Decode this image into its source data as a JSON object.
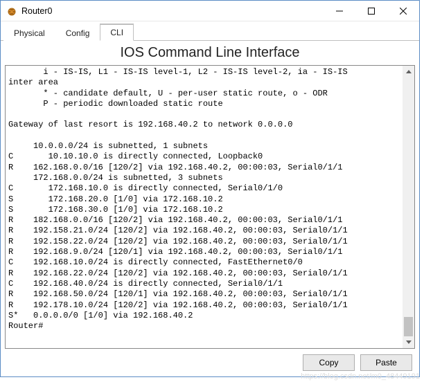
{
  "window": {
    "title": "Router0"
  },
  "tabs": [
    {
      "label": "Physical"
    },
    {
      "label": "Config"
    },
    {
      "label": "CLI"
    }
  ],
  "cli": {
    "heading": "IOS Command Line Interface",
    "lines": [
      "       i - IS-IS, L1 - IS-IS level-1, L2 - IS-IS level-2, ia - IS-IS",
      "inter area",
      "       * - candidate default, U - per-user static route, o - ODR",
      "       P - periodic downloaded static route",
      "",
      "Gateway of last resort is 192.168.40.2 to network 0.0.0.0",
      "",
      "     10.0.0.0/24 is subnetted, 1 subnets",
      "C       10.10.10.0 is directly connected, Loopback0",
      "R    162.168.0.0/16 [120/2] via 192.168.40.2, 00:00:03, Serial0/1/1",
      "     172.168.0.0/24 is subnetted, 3 subnets",
      "C       172.168.10.0 is directly connected, Serial0/1/0",
      "S       172.168.20.0 [1/0] via 172.168.10.2",
      "S       172.168.30.0 [1/0] via 172.168.10.2",
      "R    182.168.0.0/16 [120/2] via 192.168.40.2, 00:00:03, Serial0/1/1",
      "R    192.158.21.0/24 [120/2] via 192.168.40.2, 00:00:03, Serial0/1/1",
      "R    192.158.22.0/24 [120/2] via 192.168.40.2, 00:00:03, Serial0/1/1",
      "R    192.168.9.0/24 [120/1] via 192.168.40.2, 00:00:03, Serial0/1/1",
      "C    192.168.10.0/24 is directly connected, FastEthernet0/0",
      "R    192.168.22.0/24 [120/2] via 192.168.40.2, 00:00:03, Serial0/1/1",
      "C    192.168.40.0/24 is directly connected, Serial0/1/1",
      "R    192.168.50.0/24 [120/1] via 192.168.40.2, 00:00:03, Serial0/1/1",
      "R    192.178.10.0/24 [120/2] via 192.168.40.2, 00:00:03, Serial0/1/1",
      "S*   0.0.0.0/0 [1/0] via 192.168.40.2",
      "Router#"
    ]
  },
  "buttons": {
    "copy": "Copy",
    "paste": "Paste"
  },
  "watermark": "https://blog.csdn.net/m0_48449191"
}
